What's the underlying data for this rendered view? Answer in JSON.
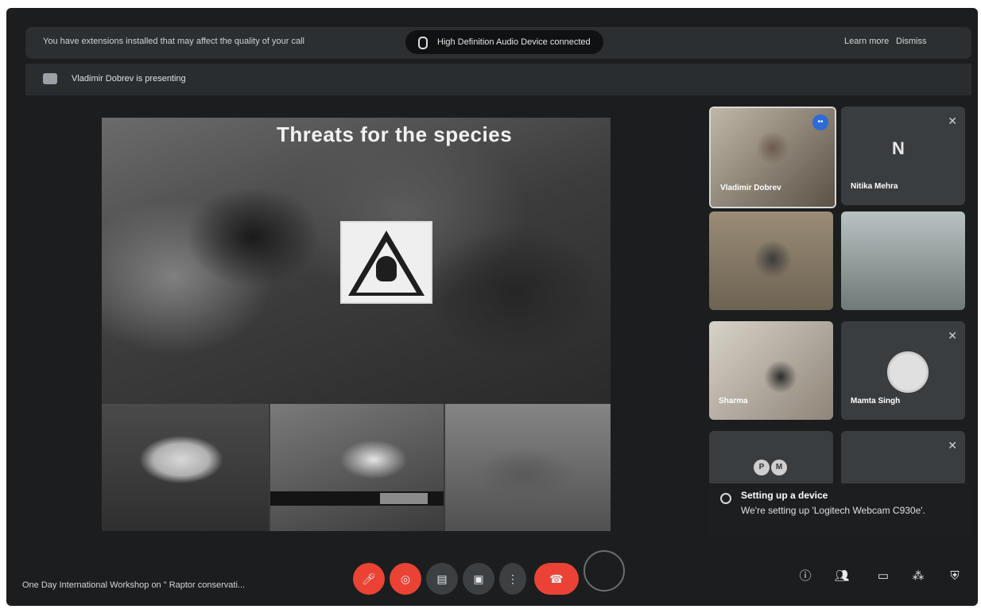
{
  "notice": {
    "text": "You have extensions installed that may affect the quality of your call",
    "device_pill": "High Definition Audio Device  connected",
    "learn_more": "Learn more",
    "dismiss": "Dismiss"
  },
  "presenting": {
    "text": "Vladimir Dobrev is presenting"
  },
  "slide": {
    "title": "Threats for the species"
  },
  "participants": [
    {
      "name": "Vladimir Dobrev",
      "speaking_badge": "••"
    },
    {
      "name": "Nitika Mehra",
      "initial": "N"
    },
    {
      "name": ""
    },
    {
      "name": ""
    },
    {
      "name": "Sharma"
    },
    {
      "name": "Mamta Singh"
    },
    {
      "name": "",
      "avatars": [
        "P",
        "M"
      ]
    },
    {
      "name": ""
    }
  ],
  "toast": {
    "title": "Setting up a device",
    "body": "We're setting up 'Logitech Webcam C930e'."
  },
  "meeting": {
    "title": "One Day International Workshop on \" Raptor conservati..."
  }
}
